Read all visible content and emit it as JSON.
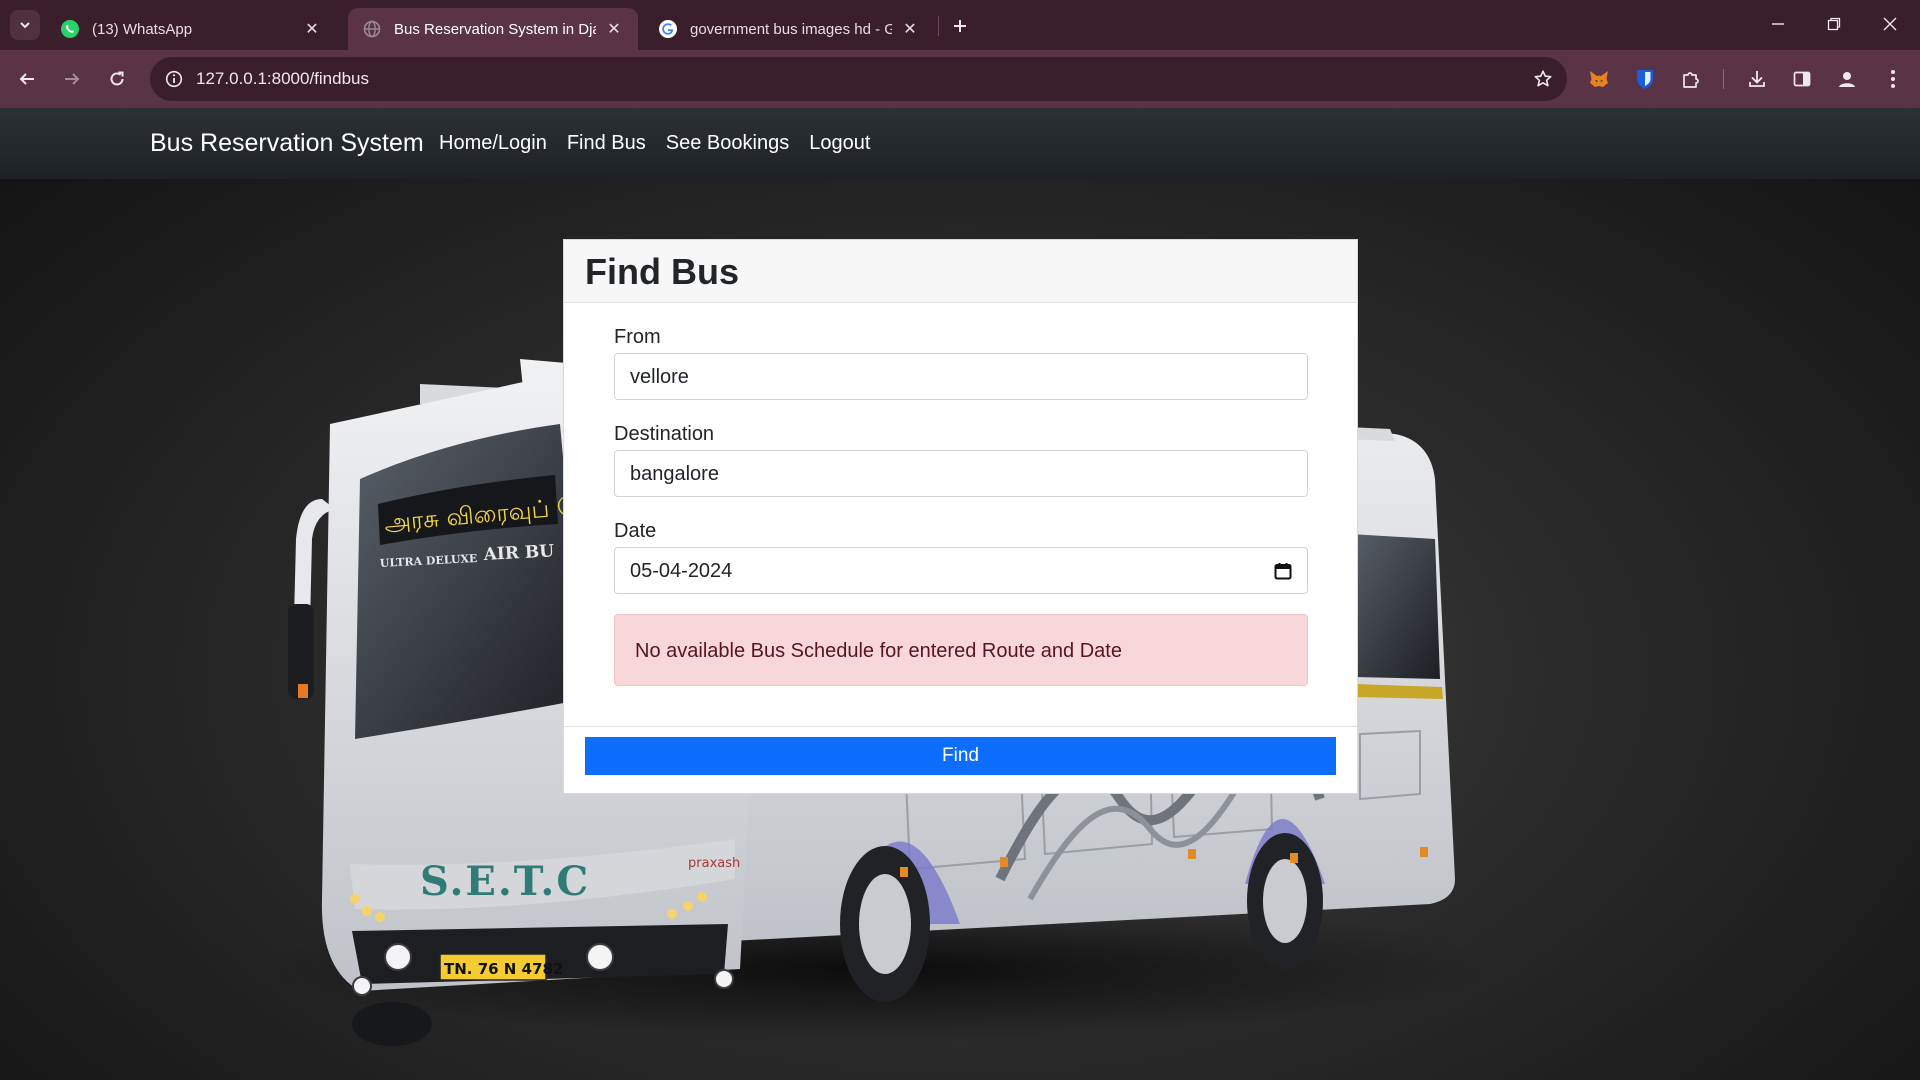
{
  "browser": {
    "tabs": [
      {
        "title": "(13) WhatsApp",
        "favicon": "whatsapp-icon"
      },
      {
        "title": "Bus Reservation System in Djan",
        "favicon": "globe-icon",
        "active": true
      },
      {
        "title": "government bus images hd - Go",
        "favicon": "google-icon"
      }
    ],
    "url": "127.0.0.1:8000/findbus"
  },
  "site": {
    "brand": "Bus Reservation System",
    "nav": {
      "home_login": "Home/Login",
      "find_bus": "Find Bus",
      "see_bookings": "See Bookings",
      "logout": "Logout"
    }
  },
  "bus_image": {
    "destination_board": "அரசு விரைவுப் போக்",
    "ultra_deluxe": "ULTRA DELUXE",
    "air_bus": "AIR BU",
    "operator": "S.E.T.C",
    "plate": "TN. 76 N 4782",
    "maker": "praxash"
  },
  "form": {
    "title": "Find Bus",
    "from_label": "From",
    "from_value": "vellore",
    "destination_label": "Destination",
    "destination_value": "bangalore",
    "date_label": "Date",
    "date_value": "05-04-2024",
    "alert": "No available Bus Schedule for entered Route and Date",
    "submit": "Find"
  },
  "colors": {
    "primary": "#0d6efd",
    "alert_bg": "#f8d7da",
    "alert_text": "#58151c",
    "browser_frame": "#3a1e2c"
  }
}
